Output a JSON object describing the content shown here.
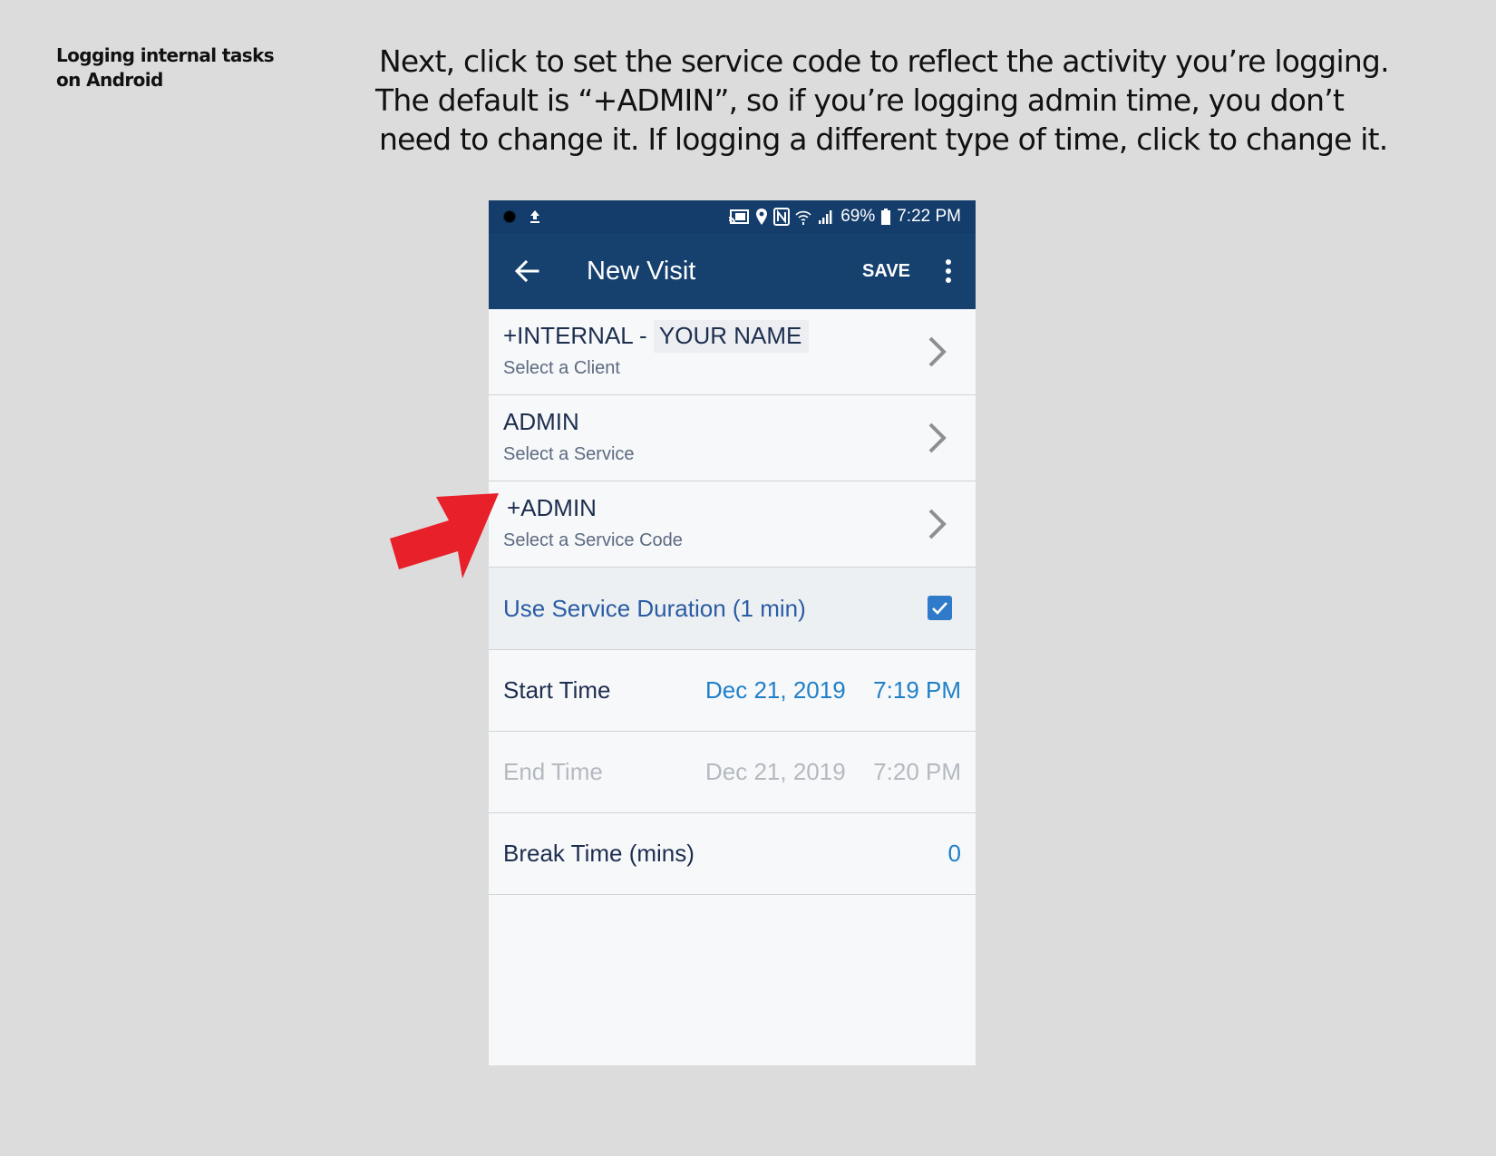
{
  "slide": {
    "side_title": "Logging internal tasks on Android",
    "instruction_lines": [
      "Next, click to set the service code to reflect the activity you’re logging.",
      "The default is “+ADMIN”, so if you’re logging admin time, you don’t",
      "need to change it. If logging a different type of time, click to change it."
    ]
  },
  "status_bar": {
    "battery": "69%",
    "time": "7:22 PM",
    "icons": [
      "camera-dot-icon",
      "upload-icon",
      "cast-icon",
      "location-icon",
      "nfc-icon",
      "wifi-icon",
      "signal-icon",
      "battery-icon"
    ]
  },
  "app_bar": {
    "title": "New Visit",
    "save_label": "SAVE",
    "icons": [
      "back-arrow-icon",
      "more-vert-icon"
    ]
  },
  "rows": {
    "client": {
      "value_prefix": "+INTERNAL -",
      "value_name": "YOUR NAME",
      "hint": "Select a Client"
    },
    "service": {
      "value": "ADMIN",
      "hint": "Select a Service"
    },
    "service_code": {
      "value": "+ADMIN",
      "hint": "Select a Service Code"
    },
    "duration": {
      "label": "Use Service Duration (1 min)",
      "checked": true
    },
    "start_time": {
      "label": "Start Time",
      "date": "Dec 21, 2019",
      "time": "7:19 PM"
    },
    "end_time": {
      "label": "End Time",
      "date": "Dec 21, 2019",
      "time": "7:20 PM",
      "enabled": false
    },
    "break_time": {
      "label": "Break Time (mins)",
      "value": "0"
    }
  },
  "colors": {
    "page_background": "#dcdcdc",
    "app_bar": "#16416f",
    "status_bar": "#143d6c",
    "accent_blue": "#1f80c8",
    "checkbox": "#2f7bc9",
    "callout_arrow": "#e8202a"
  }
}
